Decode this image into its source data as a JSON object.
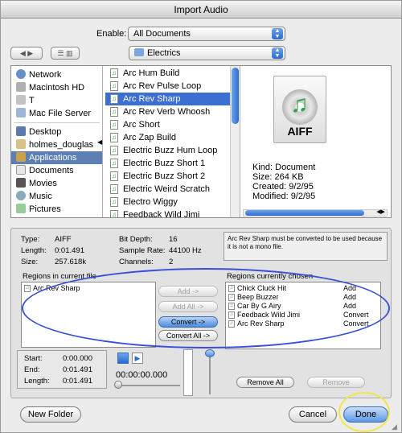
{
  "window": {
    "title": "Import Audio"
  },
  "enable": {
    "label": "Enable:",
    "value": "All Documents"
  },
  "location": {
    "value": "Electrics"
  },
  "sidebar": {
    "items": [
      {
        "label": "Network",
        "icon": "network-icon"
      },
      {
        "label": "Macintosh HD",
        "icon": "hard-drive-icon"
      },
      {
        "label": "T",
        "icon": "disk-icon"
      },
      {
        "label": "Mac File Server",
        "icon": "server-icon"
      },
      {
        "label": "Desktop",
        "icon": "desktop-icon"
      },
      {
        "label": "holmes_douglas",
        "icon": "home-icon"
      },
      {
        "label": "Applications",
        "icon": "applications-icon",
        "selected": true
      },
      {
        "label": "Documents",
        "icon": "documents-icon"
      },
      {
        "label": "Movies",
        "icon": "movies-icon"
      },
      {
        "label": "Music",
        "icon": "music-icon"
      },
      {
        "label": "Pictures",
        "icon": "pictures-icon"
      }
    ]
  },
  "files": {
    "items": [
      "Arc Hum Build",
      "Arc Rev Pulse Loop",
      "Arc Rev Sharp",
      "Arc Rev Verb Whoosh",
      "Arc Short",
      "Arc Zap Build",
      "Electric Buzz Hum Loop",
      "Electric Buzz Short 1",
      "Electric Buzz Short 2",
      "Electric Weird Scratch",
      "Electro Wiggy",
      "Feedback Wild Jimi"
    ],
    "selected_index": 2
  },
  "preview": {
    "icon_text": "AIFF",
    "kind": "Kind: Document",
    "size": "Size: 264 KB",
    "created": "Created: 9/2/95",
    "modified": "Modified: 9/2/95"
  },
  "info": {
    "type_label": "Type:",
    "type_value": "AIFF",
    "length_label": "Length:",
    "length_value": "0:01.491",
    "size_label": "Size:",
    "size_value": "257.618k",
    "bitdepth_label": "Bit Depth:",
    "bitdepth_value": "16",
    "samplerate_label": "Sample Rate:",
    "samplerate_value": "44100 Hz",
    "channels_label": "Channels:",
    "channels_value": "2",
    "message": "Arc Rev Sharp must be converted to be used because it is not a mono file."
  },
  "regions_current": {
    "title": "Regions in current file",
    "items": [
      "Arc Rev Sharp"
    ]
  },
  "regions_chosen": {
    "title": "Regions currently chosen",
    "items": [
      {
        "name": "Chick Cluck Hit",
        "action": "Add"
      },
      {
        "name": "Beep Buzzer",
        "action": "Add"
      },
      {
        "name": "Car By G Airy",
        "action": "Add"
      },
      {
        "name": "Feedback Wild Jimi",
        "action": "Convert"
      },
      {
        "name": "Arc Rev Sharp",
        "action": "Convert"
      }
    ]
  },
  "buttons": {
    "add": "Add ->",
    "add_all": "Add All ->",
    "convert": "Convert ->",
    "convert_all": "Convert All ->",
    "remove_all": "Remove All",
    "remove": "Remove",
    "new_folder": "New Folder",
    "cancel": "Cancel",
    "done": "Done"
  },
  "times": {
    "start_label": "Start:",
    "start_value": "0:00.000",
    "end_label": "End:",
    "end_value": "0:01.491",
    "length_label": "Length:",
    "length_value": "0:01.491",
    "playhead": "00:00:00.000"
  },
  "colors": {
    "selection": "#3b6fd1",
    "annotation_ellipse": "#3a4fd8",
    "annotation_highlight": "#efe64a"
  }
}
